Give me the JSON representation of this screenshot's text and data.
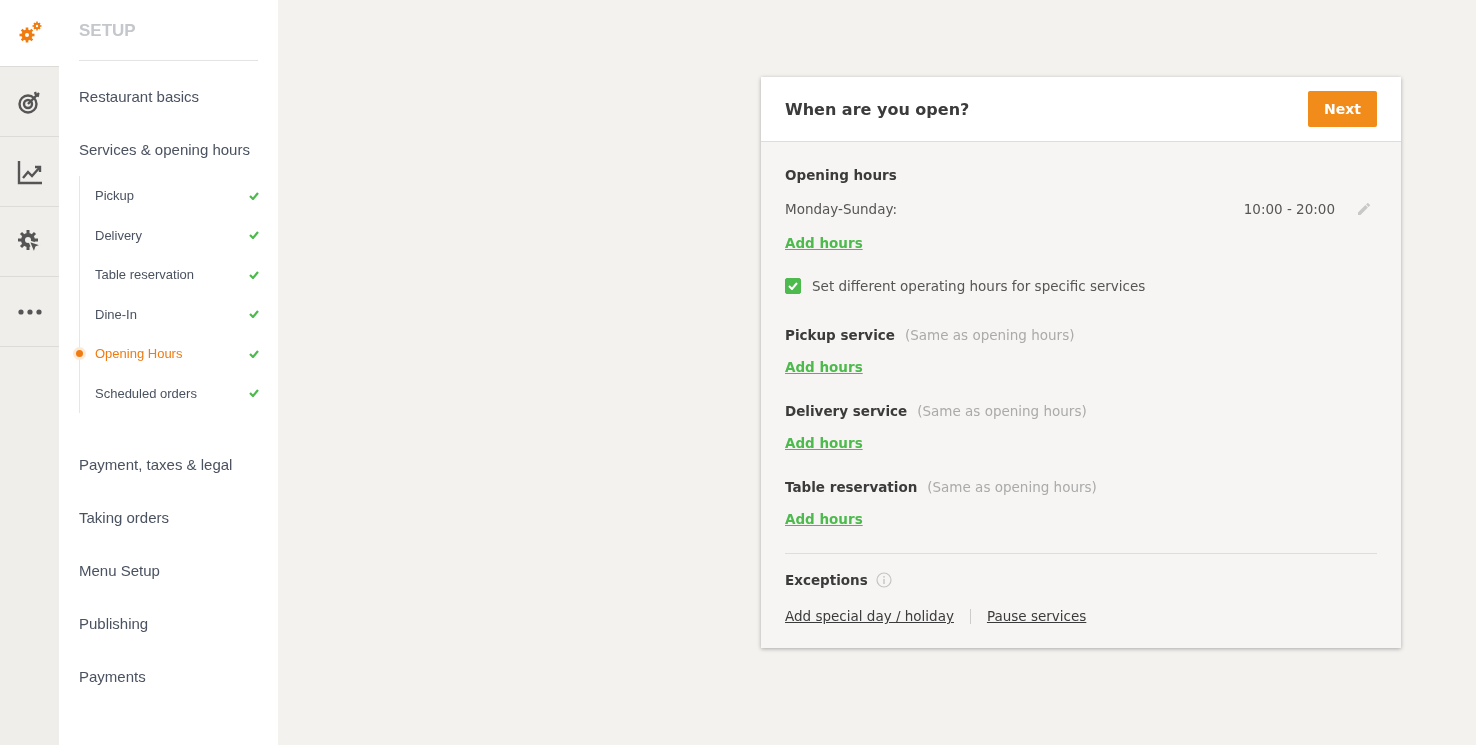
{
  "rail": [
    {
      "kind": "gears",
      "selected": true
    },
    {
      "kind": "target",
      "selected": false
    },
    {
      "kind": "chart",
      "selected": false
    },
    {
      "kind": "cursor",
      "selected": false
    },
    {
      "kind": "more",
      "selected": false
    }
  ],
  "sidebar": {
    "title": "SETUP",
    "items": [
      {
        "label": "Restaurant basics"
      },
      {
        "label": "Services & opening hours",
        "children": [
          {
            "label": "Pickup",
            "selected": false,
            "done": true
          },
          {
            "label": "Delivery",
            "selected": false,
            "done": true
          },
          {
            "label": "Table reservation",
            "selected": false,
            "done": true
          },
          {
            "label": "Dine-In",
            "selected": false,
            "done": true
          },
          {
            "label": "Opening Hours",
            "selected": true,
            "done": true
          },
          {
            "label": "Scheduled orders",
            "selected": false,
            "done": true
          }
        ]
      },
      {
        "label": "Payment, taxes & legal"
      },
      {
        "label": "Taking orders"
      },
      {
        "label": "Menu Setup"
      },
      {
        "label": "Publishing"
      },
      {
        "label": "Payments"
      }
    ]
  },
  "card": {
    "title": "When are you open?",
    "next_button": "Next",
    "opening_hours": {
      "heading": "Opening hours",
      "days": "Monday-Sunday:",
      "hours": "10:00 - 20:00",
      "add_link": "Add hours"
    },
    "different_hours": {
      "label": "Set different operating hours for specific services",
      "checked": true
    },
    "services": [
      {
        "name": "Pickup service",
        "note": "(Same as opening hours)",
        "add_link": "Add hours"
      },
      {
        "name": "Delivery service",
        "note": "(Same as opening hours)",
        "add_link": "Add hours"
      },
      {
        "name": "Table reservation",
        "note": "(Same as opening hours)",
        "add_link": "Add hours"
      }
    ],
    "exceptions": {
      "heading": "Exceptions",
      "links": [
        "Add special day / holiday",
        "Pause services"
      ]
    }
  }
}
